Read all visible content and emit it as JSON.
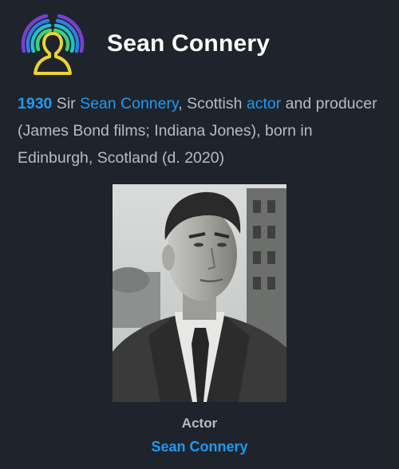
{
  "header": {
    "title": "Sean Connery",
    "logo_icon": "person-radio-waves-icon"
  },
  "description": {
    "year": "1930",
    "prefix": " Sir ",
    "name_link": "Sean Connery",
    "middle": ", Scottish ",
    "role_link": "actor",
    "suffix": " and producer (James Bond films; Indiana Jones), born in Edinburgh, Scotland (d. 2020)"
  },
  "photo": {
    "icon": "portrait-photo"
  },
  "caption": {
    "label": "Actor",
    "name": "Sean Connery"
  },
  "colors": {
    "background": "#1f242c",
    "accent": "#1e9af0",
    "text": "#b6bcc5",
    "title": "#ffffff"
  }
}
